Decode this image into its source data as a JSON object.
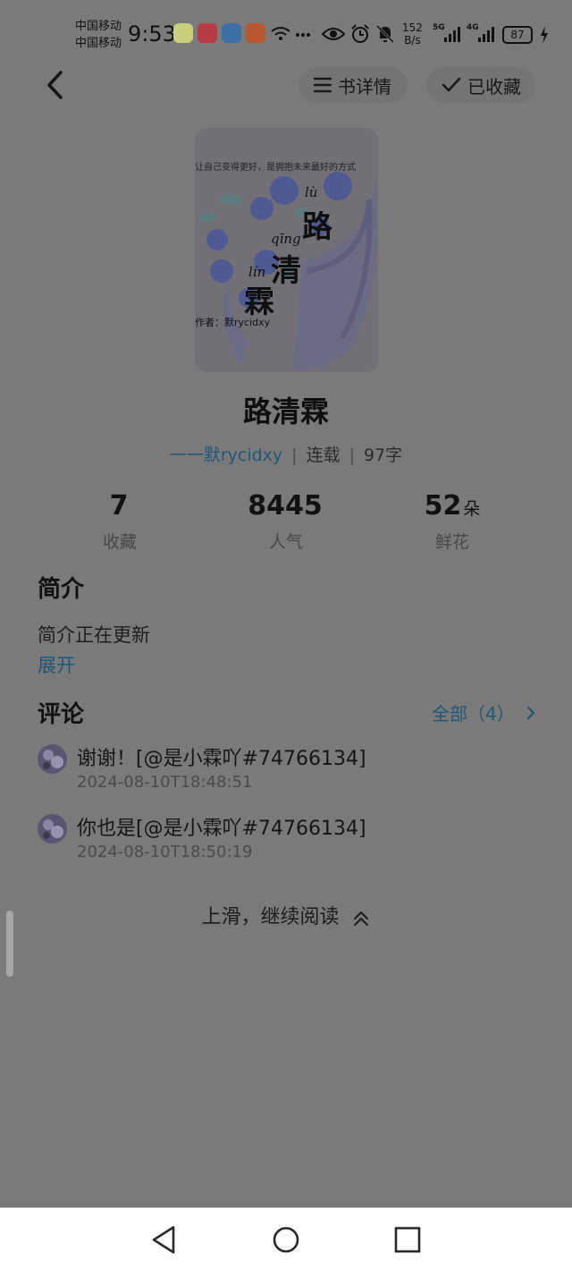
{
  "status_bar": {
    "carrier_1": "中国移动",
    "carrier_2": "中国移动",
    "time": "9:53",
    "net_speed_value": "152",
    "net_speed_unit": "B/s",
    "signal_1_label": "5G",
    "signal_2_label": "4G",
    "battery": "87",
    "app_icons": [
      "notification-app-icon",
      "xiaohongshu-icon",
      "compass-app-icon",
      "orange-app-icon"
    ]
  },
  "top_bar": {
    "details_label": "书详情",
    "favorite_label": "已收藏"
  },
  "cover": {
    "tag_text": "让自己变得更好，是拥抱未来最好的方式",
    "title_chars": [
      "路",
      "清",
      "霖"
    ],
    "pinyin": [
      "lù",
      "qīng",
      "lín"
    ],
    "author_text": "作者：默rycidxy"
  },
  "book": {
    "title": "路清霖",
    "author": "一一默rycidxy",
    "status": "连载",
    "word_count": "97字"
  },
  "stats": [
    {
      "value": "7",
      "unit": "",
      "label": "收藏"
    },
    {
      "value": "8445",
      "unit": "",
      "label": "人气"
    },
    {
      "value": "52",
      "unit": "朵",
      "label": "鲜花"
    }
  ],
  "intro": {
    "heading": "简介",
    "text": "简介正在更新",
    "expand_label": "展开"
  },
  "comments": {
    "heading": "评论",
    "all_label": "全部（4）",
    "items": [
      {
        "text": "谢谢！[@是小霖吖#74766134]",
        "time": "2024-08-10T18:48:51"
      },
      {
        "text": "你也是[@是小霖吖#74766134]",
        "time": "2024-08-10T18:50:19"
      }
    ]
  },
  "footer": {
    "continue_label": "上滑，继续阅读"
  },
  "colors": {
    "overlay_background": "#7a7a7a",
    "link_blue": "#1f5678",
    "navbar_background": "#fdfdfd"
  }
}
